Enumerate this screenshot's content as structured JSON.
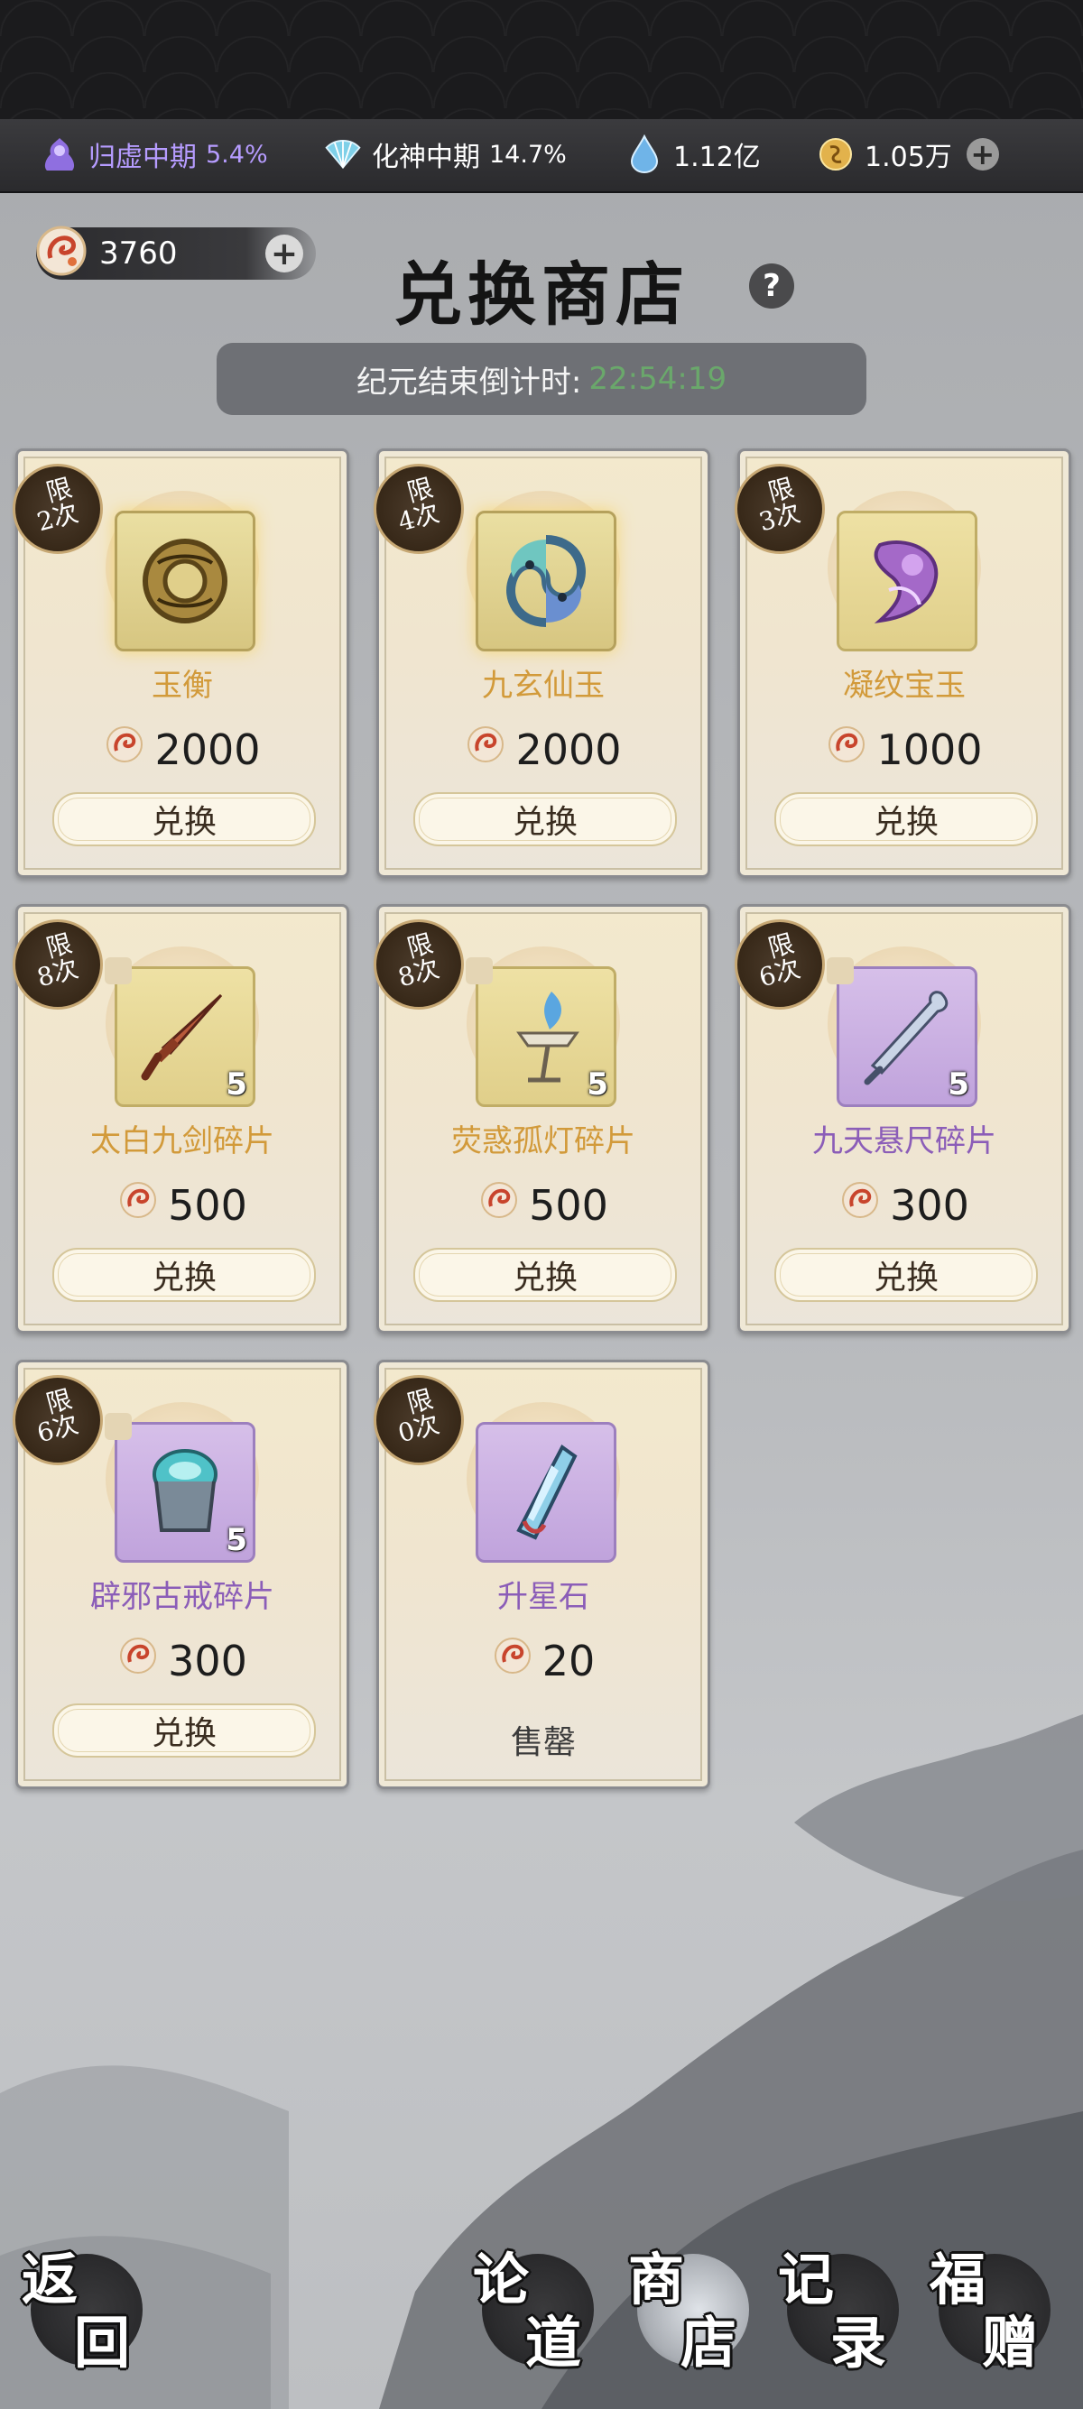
{
  "status_bar": {
    "realm_1": {
      "label": "归虚中期",
      "pct": "5.4%"
    },
    "realm_2": {
      "label": "化神中期",
      "pct": "14.7%"
    },
    "spirit_stones": "1.12亿",
    "copper": "1.05万"
  },
  "currency": {
    "amount": "3760"
  },
  "header": {
    "title": "兑换商店",
    "help": "?",
    "countdown_label": "纪元结束倒计时:",
    "countdown_time": "22:54:19"
  },
  "shop_items": [
    {
      "limit_1": "限",
      "limit_2": "2次",
      "name": "玉衡",
      "price": "2000",
      "action": "兑换"
    },
    {
      "limit_1": "限",
      "limit_2": "4次",
      "name": "九玄仙玉",
      "price": "2000",
      "action": "兑换"
    },
    {
      "limit_1": "限",
      "limit_2": "3次",
      "name": "凝纹宝玉",
      "price": "1000",
      "action": "兑换"
    },
    {
      "limit_1": "限",
      "limit_2": "8次",
      "name": "太白九剑碎片",
      "price": "500",
      "action": "兑换",
      "qty": "5"
    },
    {
      "limit_1": "限",
      "limit_2": "8次",
      "name": "荧惑孤灯碎片",
      "price": "500",
      "action": "兑换",
      "qty": "5"
    },
    {
      "limit_1": "限",
      "limit_2": "6次",
      "name": "九天悬尺碎片",
      "price": "300",
      "action": "兑换",
      "qty": "5"
    },
    {
      "limit_1": "限",
      "limit_2": "6次",
      "name": "辟邪古戒碎片",
      "price": "300",
      "action": "兑换",
      "qty": "5"
    },
    {
      "limit_1": "限",
      "limit_2": "0次",
      "name": "升星石",
      "price": "20",
      "status": "售罄"
    }
  ],
  "bottom_nav": {
    "back": {
      "c1": "返",
      "c2": "回"
    },
    "discuss": {
      "c1": "论",
      "c2": "道"
    },
    "shop": {
      "c1": "商",
      "c2": "店"
    },
    "records": {
      "c1": "记",
      "c2": "录"
    },
    "gifts": {
      "c1": "福",
      "c2": "赠"
    }
  },
  "colors": {
    "countdown_time": "#6aa86b",
    "gold_name": "#d29a3a",
    "purple_name": "#8b5db8",
    "realm_1_text": "#b69cff"
  }
}
